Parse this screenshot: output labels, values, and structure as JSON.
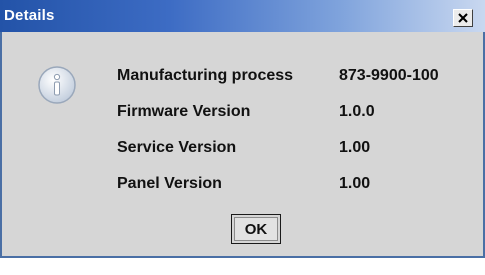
{
  "window": {
    "title": "Details",
    "close_icon": "close-icon"
  },
  "icon": {
    "name": "info-icon",
    "glyph": "i",
    "color": "#e8eef8"
  },
  "details": [
    {
      "label": "Manufacturing process",
      "value": "873-9900-100"
    },
    {
      "label": "Firmware Version",
      "value": "1.0.0"
    },
    {
      "label": "Service Version",
      "value": "1.00"
    },
    {
      "label": "Panel Version",
      "value": "1.00"
    }
  ],
  "buttons": {
    "ok_label": "OK"
  },
  "colors": {
    "titlebar_start": "#2353a8",
    "titlebar_end": "#c9d8f0",
    "dialog_background": "#d6d6d6"
  }
}
